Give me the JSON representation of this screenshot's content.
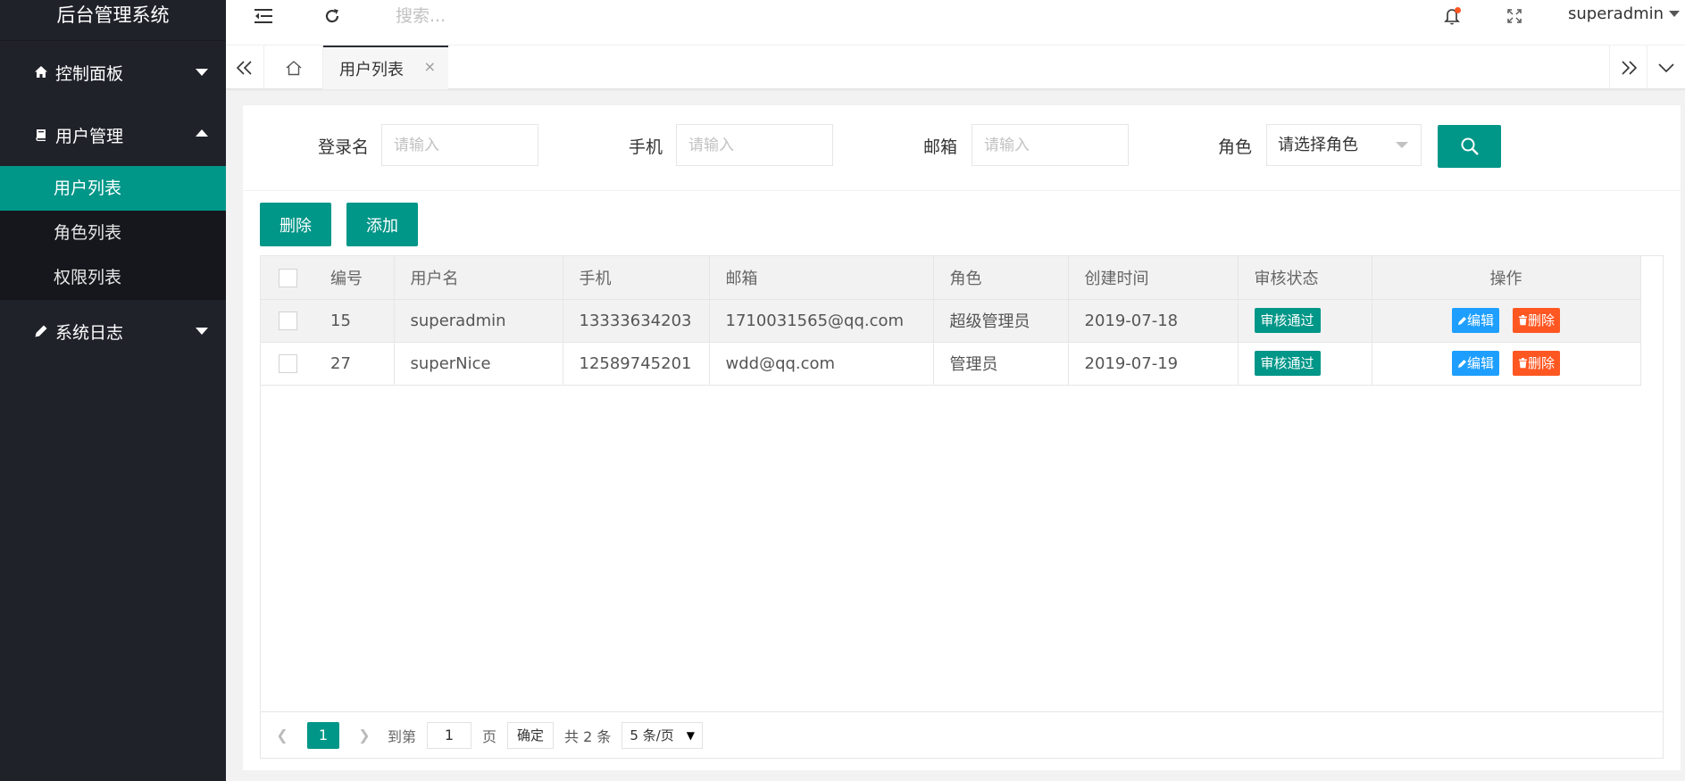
{
  "app": {
    "title": "后台管理系统"
  },
  "sidebar": {
    "groups": [
      {
        "label": "控制面板",
        "icon": "home-icon",
        "expanded": false
      },
      {
        "label": "用户管理",
        "icon": "book-icon",
        "expanded": true,
        "items": [
          {
            "label": "用户列表",
            "active": true
          },
          {
            "label": "角色列表"
          },
          {
            "label": "权限列表"
          }
        ]
      },
      {
        "label": "系统日志",
        "icon": "pencil-icon",
        "expanded": false
      }
    ]
  },
  "header": {
    "search_placeholder": "搜索...",
    "username": "superadmin"
  },
  "tabs": {
    "active_label": "用户列表",
    "close_glyph": "×"
  },
  "filter": {
    "login_label": "登录名",
    "login_placeholder": "请输入",
    "phone_label": "手机",
    "phone_placeholder": "请输入",
    "email_label": "邮箱",
    "email_placeholder": "请输入",
    "role_label": "角色",
    "role_value": "请选择角色"
  },
  "buttons": {
    "delete": "删除",
    "add": "添加"
  },
  "table": {
    "columns": [
      "编号",
      "用户名",
      "手机",
      "邮箱",
      "角色",
      "创建时间",
      "审核状态",
      "操作"
    ],
    "rows": [
      {
        "id": "15",
        "username": "superadmin",
        "phone": "13333634203",
        "email": "1710031565@qq.com",
        "role": "超级管理员",
        "created": "2019-07-18",
        "status": "审核通过",
        "edit": "编辑",
        "delete": "删除"
      },
      {
        "id": "27",
        "username": "superNice",
        "phone": "12589745201",
        "email": "wdd@qq.com",
        "role": "管理员",
        "created": "2019-07-19",
        "status": "审核通过",
        "edit": "编辑",
        "delete": "删除"
      }
    ]
  },
  "pager": {
    "current_page": "1",
    "goto_label": "到第",
    "goto_value": "1",
    "page_unit": "页",
    "confirm": "确定",
    "total": "共 2 条",
    "page_size": "5 条/页"
  },
  "colors": {
    "primary": "#009688",
    "sidebar_bg": "#20222a",
    "edit": "#1e9fff",
    "danger": "#ff5722",
    "notify_dot": "#ff5722"
  }
}
